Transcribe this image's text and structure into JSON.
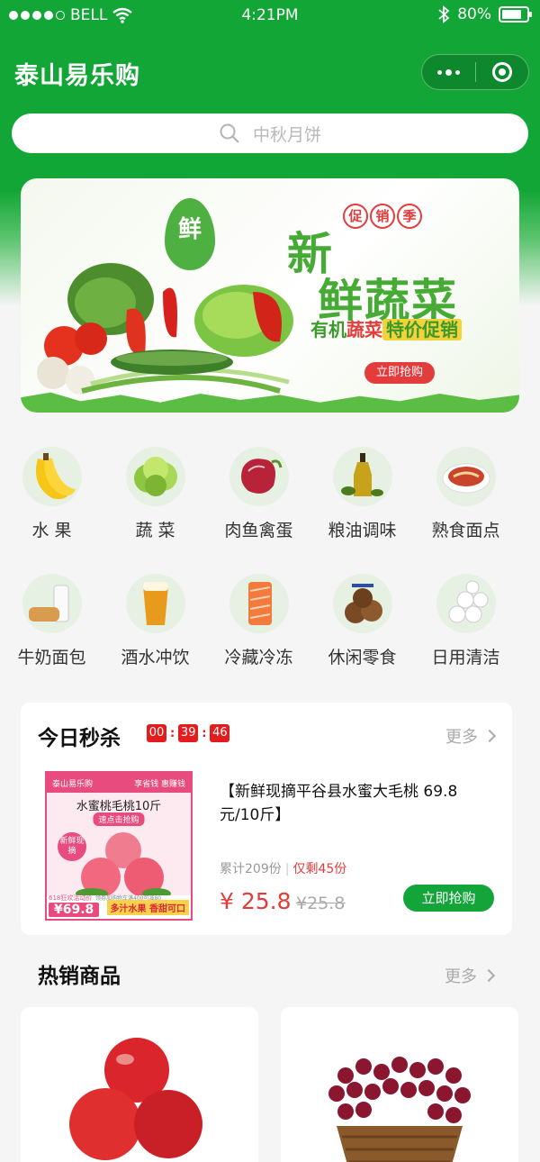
{
  "status_bar": {
    "carrier": "BELL",
    "time": "4:21PM",
    "battery": "80%",
    "battery_level": 0.8
  },
  "nav": {
    "title": "泰山易乐购"
  },
  "search": {
    "placeholder": "中秋月饼"
  },
  "banner": {
    "logo_char": "鲜",
    "badge_chars": [
      "促",
      "销",
      "季"
    ],
    "title_line1": "新",
    "title_line2_a": "鲜",
    "title_line2_b": "蔬菜",
    "subtitle_a": "有机",
    "subtitle_b": "蔬菜",
    "subtitle_c": "特价促销",
    "button": "立即抢购",
    "colors": {
      "green": "#46ab35",
      "red": "#e23c3c",
      "yellow": "#f3d339"
    }
  },
  "categories": [
    {
      "label": "水 果",
      "icon": "banana-icon"
    },
    {
      "label": "蔬 菜",
      "icon": "lettuce-icon"
    },
    {
      "label": "肉鱼禽蛋",
      "icon": "steak-icon"
    },
    {
      "label": "粮油调味",
      "icon": "oil-bottle-icon"
    },
    {
      "label": "熟食面点",
      "icon": "noodle-bowl-icon"
    },
    {
      "label": "牛奶面包",
      "icon": "milk-bread-icon"
    },
    {
      "label": "酒水冲饮",
      "icon": "beer-icon"
    },
    {
      "label": "冷藏冷冻",
      "icon": "salmon-icon"
    },
    {
      "label": "休闲零食",
      "icon": "cookies-icon"
    },
    {
      "label": "日用清洁",
      "icon": "tissue-rolls-icon"
    }
  ],
  "flash_sale": {
    "title": "今日秒杀",
    "countdown": [
      "00",
      "39",
      "46"
    ],
    "more": "更多",
    "product": {
      "image_store": "泰山易乐购",
      "image_slogan_top": "享省钱 惠赚钱",
      "image_name": "水蜜桃毛桃10斤",
      "image_tag": "速点击抢购",
      "image_fresh": "新鲜现摘",
      "image_event": "618狂欢活动价",
      "image_price": "¥69.8",
      "image_coupon": "领券加购物车满400可减80",
      "image_footer": "多汁水果 香甜可口",
      "title": "【新鲜现摘平谷县水蜜大毛桃   69.8元/10斤】",
      "sold": "累计209份",
      "remaining": "仅剩45份",
      "price": "¥ 25.8",
      "old_price": "¥25.8",
      "button": "立即抢购"
    },
    "accent": "#e31d1d",
    "button_color": "#13a53a"
  },
  "hot": {
    "title": "热销商品",
    "more": "更多",
    "items": [
      {
        "icon": "nectarine-icon"
      },
      {
        "icon": "grapes-basket-icon"
      }
    ]
  }
}
